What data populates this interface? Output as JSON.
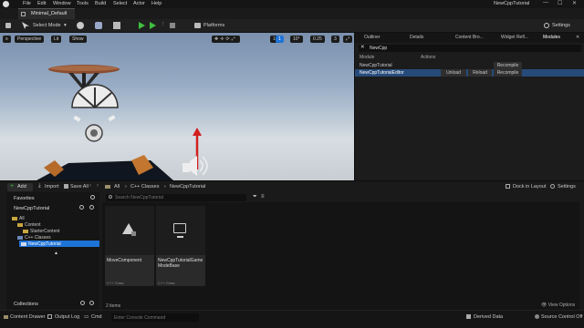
{
  "menu": [
    "File",
    "Edit",
    "Window",
    "Tools",
    "Build",
    "Select",
    "Actor",
    "Help"
  ],
  "window_title": "NewCppTutorial",
  "map_tab": "Minimal_Default",
  "toolbar": {
    "select_mode": "Select Mode",
    "platforms": "Platforms",
    "settings": "Settings"
  },
  "viewport": {
    "perspective": "Perspective",
    "lit": "Lit",
    "show": "Show",
    "grid_snap": "10",
    "rot_snap": "10°",
    "scale_snap": "0.25",
    "cam_speed": "3",
    "layer_count": "1"
  },
  "right_tabs": [
    "Outliner",
    "Details",
    "Content Bro...",
    "Widget Refl...",
    "Modules"
  ],
  "modules": {
    "search_value": "NewCpp",
    "col_module": "Module",
    "col_actions": "Actions",
    "rows": [
      {
        "name": "NewCppTutorial",
        "unload": "",
        "reload": "",
        "recompile": "Recompile"
      },
      {
        "name": "NewCppTutorialEditor",
        "unload": "Unload",
        "reload": "Reload",
        "recompile": "Recompile"
      }
    ]
  },
  "content_browser": {
    "add": "Add",
    "import": "Import",
    "save_all": "Save All",
    "path": [
      "All",
      "C++ Classes",
      "NewCppTutorial"
    ],
    "dock": "Dock in Layout",
    "settings": "Settings",
    "favorites": "Favorites",
    "project": "NewCppTutorial",
    "tree": [
      "All",
      "Content",
      "StarterContent",
      "C++ Classes",
      "NewCppTutorial"
    ],
    "search_placeholder": "Search NewCppTutorial",
    "collections": "Collections",
    "items_count": "2 items",
    "tiles": [
      {
        "name": "MoveComponent",
        "type": "C++ Class"
      },
      {
        "name": "NewCppTutorialGame ModeBase",
        "type": "C++ Class"
      }
    ]
  },
  "statusbar": {
    "content_drawer": "Content Drawer",
    "output_log": "Output Log",
    "cmd": "Cmd",
    "cmd_placeholder": "Enter Console Command",
    "derived_data": "Derived Data",
    "source_control": "Source Control Off"
  },
  "colors": {
    "accent": "#1e73d6",
    "play": "#3fbf3f",
    "selection": "#264b7a"
  }
}
